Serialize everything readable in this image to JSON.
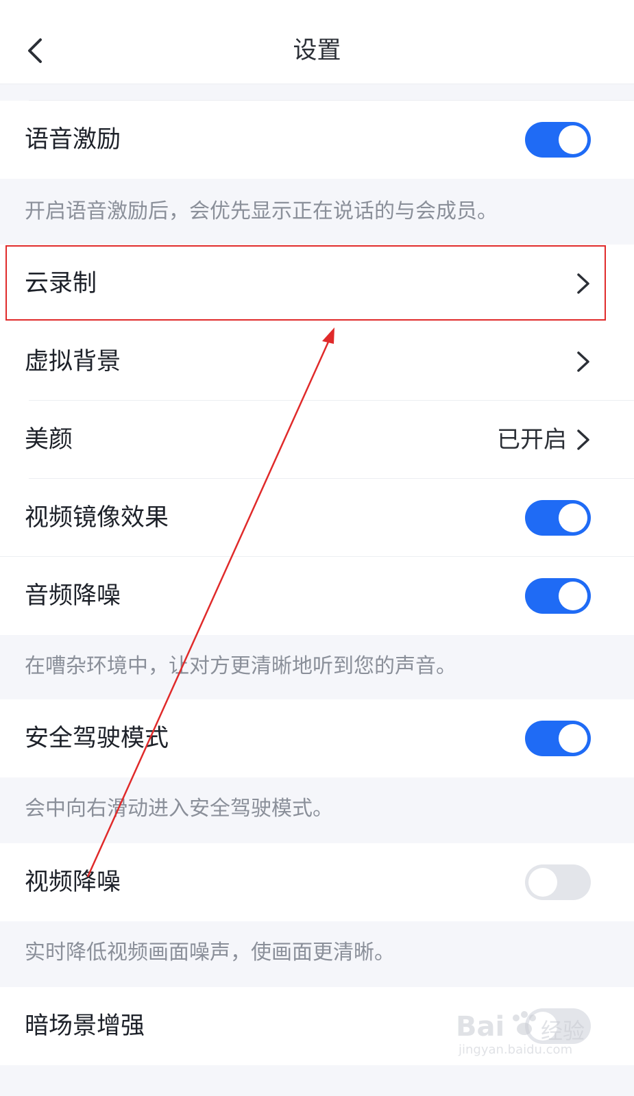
{
  "header": {
    "title": "设置"
  },
  "settings": [
    {
      "label": "语音激励",
      "type": "toggle",
      "on": true
    },
    {
      "label": "云录制",
      "type": "link"
    },
    {
      "label": "虚拟背景",
      "type": "link"
    },
    {
      "label": "美颜",
      "type": "link",
      "value": "已开启"
    },
    {
      "label": "视频镜像效果",
      "type": "toggle",
      "on": true
    },
    {
      "label": "音频降噪",
      "type": "toggle",
      "on": true
    },
    {
      "label": "安全驾驶模式",
      "type": "toggle",
      "on": true
    },
    {
      "label": "视频降噪",
      "type": "toggle",
      "on": false
    },
    {
      "label": "暗场景增强",
      "type": "toggle",
      "on": false
    }
  ],
  "descriptions": {
    "voice_motivation": "开启语音激励后，会优先显示正在说话的与会成员。",
    "audio_denoise": "在嘈杂环境中，让对方更清晰地听到您的声音。",
    "safe_driving": "会中向右滑动进入安全驾驶模式。",
    "video_denoise": "实时降低视频画面噪声，使画面更清晰。"
  },
  "colors": {
    "accent": "#1f6bf5",
    "annotation": "#e02a2a",
    "toggle_off": "#e3e5ea"
  },
  "watermark": {
    "brand": "Bai",
    "suffix": "经验",
    "url": "jingyan.baidu.com"
  }
}
